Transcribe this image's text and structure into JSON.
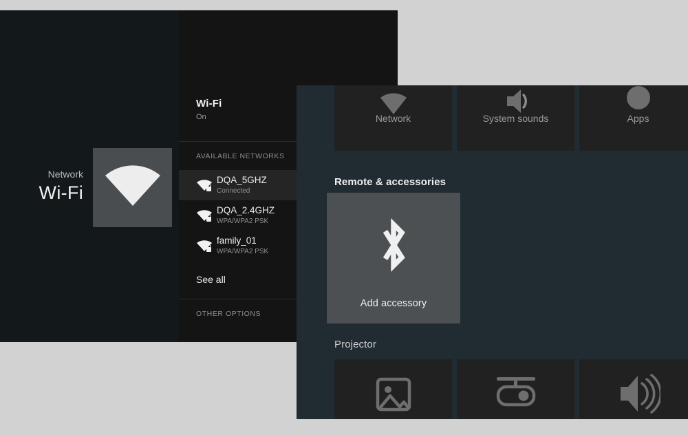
{
  "wifi_window": {
    "hero": {
      "kicker": "Network",
      "title": "Wi-Fi",
      "icon": "wifi-icon"
    },
    "list": {
      "title": "Wi-Fi",
      "state": "On",
      "available_section_label": "AVAILABLE NETWORKS",
      "networks": [
        {
          "ssid": "DQA_5GHZ",
          "status": "Connected",
          "icon": "wifi-lock-icon",
          "selected": true
        },
        {
          "ssid": "DQA_2.4GHZ",
          "status": "WPA/WPA2 PSK",
          "icon": "wifi-lock-icon",
          "selected": false
        },
        {
          "ssid": "family_01",
          "status": "WPA/WPA2 PSK",
          "icon": "wifi-lock-icon",
          "selected": false
        }
      ],
      "see_all_label": "See all",
      "other_section_label": "OTHER OPTIONS"
    }
  },
  "tv_window": {
    "top_tiles": [
      {
        "label": "Network",
        "icon": "wifi-triangle-icon"
      },
      {
        "label": "System sounds",
        "icon": "sound-wave-icon"
      },
      {
        "label": "Apps",
        "icon": "apps-circle-icon"
      }
    ],
    "remote_heading": "Remote & accessories",
    "accessory_tile": {
      "label": "Add accessory",
      "icon": "bluetooth-icon"
    },
    "projector_heading": "Projector",
    "bottom_tiles": [
      {
        "label": "",
        "icon": "image-icon"
      },
      {
        "label": "",
        "icon": "projector-icon"
      },
      {
        "label": "",
        "icon": "volume-icon"
      }
    ]
  },
  "colors": {
    "desktop": "#d2d2d2",
    "wifi_window_bg": "#13181b",
    "wifi_list_bg": "#141414",
    "selected_row": "#252525",
    "tv_window_bg": "#212b32",
    "tile_bg": "#212121",
    "accessory_tile_bg": "#4d5053",
    "hero_tile_bg": "#4a4d50"
  }
}
